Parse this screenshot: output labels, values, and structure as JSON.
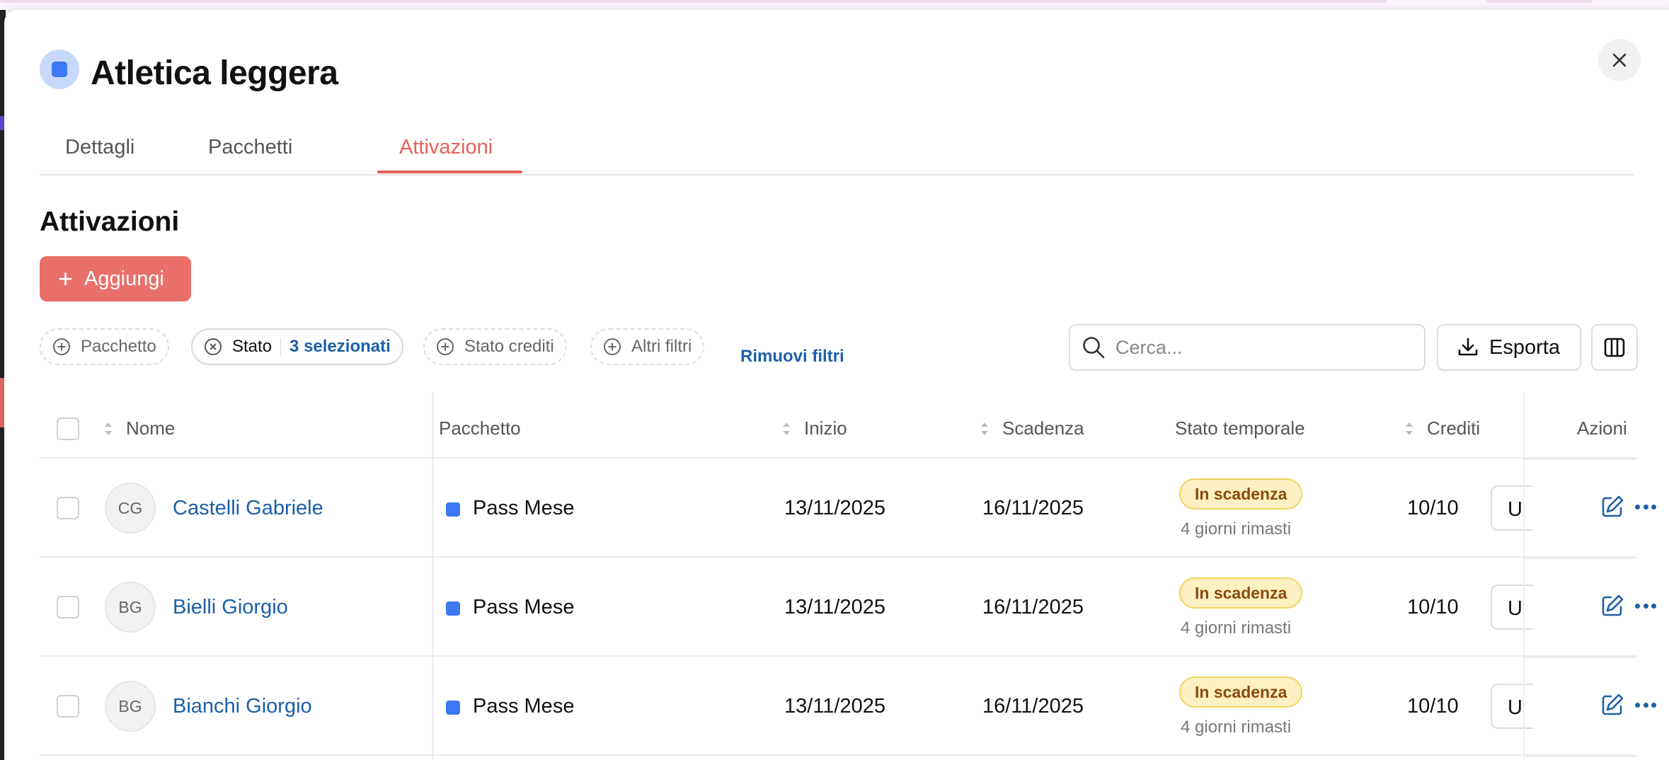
{
  "modal": {
    "title": "Atletica leggera",
    "accent_color": "#3b78f2",
    "close_icon": "close-icon"
  },
  "tabs": [
    {
      "label": "Dettagli",
      "active": false
    },
    {
      "label": "Pacchetti",
      "active": false
    },
    {
      "label": "Attivazioni",
      "active": true
    }
  ],
  "section": {
    "title": "Attivazioni",
    "add_label": "Aggiungi"
  },
  "filters": {
    "pacchetto": "Pacchetto",
    "stato": "Stato",
    "stato_selected": "3 selezionati",
    "stato_crediti": "Stato crediti",
    "altri_filtri": "Altri filtri",
    "remove": "Rimuovi filtri"
  },
  "search": {
    "placeholder": "Cerca...",
    "value": ""
  },
  "export_label": "Esporta",
  "table": {
    "headers": {
      "nome": "Nome",
      "pacchetto": "Pacchetto",
      "inizio": "Inizio",
      "scadenza": "Scadenza",
      "stato_temporale": "Stato temporale",
      "crediti": "Crediti",
      "azioni": "Azioni"
    },
    "rows": [
      {
        "initials": "CG",
        "name": "Castelli Gabriele",
        "package": "Pass Mese",
        "start": "13/11/2025",
        "end": "16/11/2025",
        "status": "In scadenza",
        "days": "4 giorni rimasti",
        "credits": "10/10",
        "use": "U"
      },
      {
        "initials": "BG",
        "name": "Bielli Giorgio",
        "package": "Pass Mese",
        "start": "13/11/2025",
        "end": "16/11/2025",
        "status": "In scadenza",
        "days": "4 giorni rimasti",
        "credits": "10/10",
        "use": "U"
      },
      {
        "initials": "BG",
        "name": "Bianchi Giorgio",
        "package": "Pass Mese",
        "start": "13/11/2025",
        "end": "16/11/2025",
        "status": "In scadenza",
        "days": "4 giorni rimasti",
        "credits": "10/10",
        "use": "U"
      }
    ]
  },
  "colors": {
    "primary": "#e9706a",
    "link": "#1c5fa8",
    "badge_bg": "#fdf1c3",
    "badge_text": "#8a4b0b"
  }
}
